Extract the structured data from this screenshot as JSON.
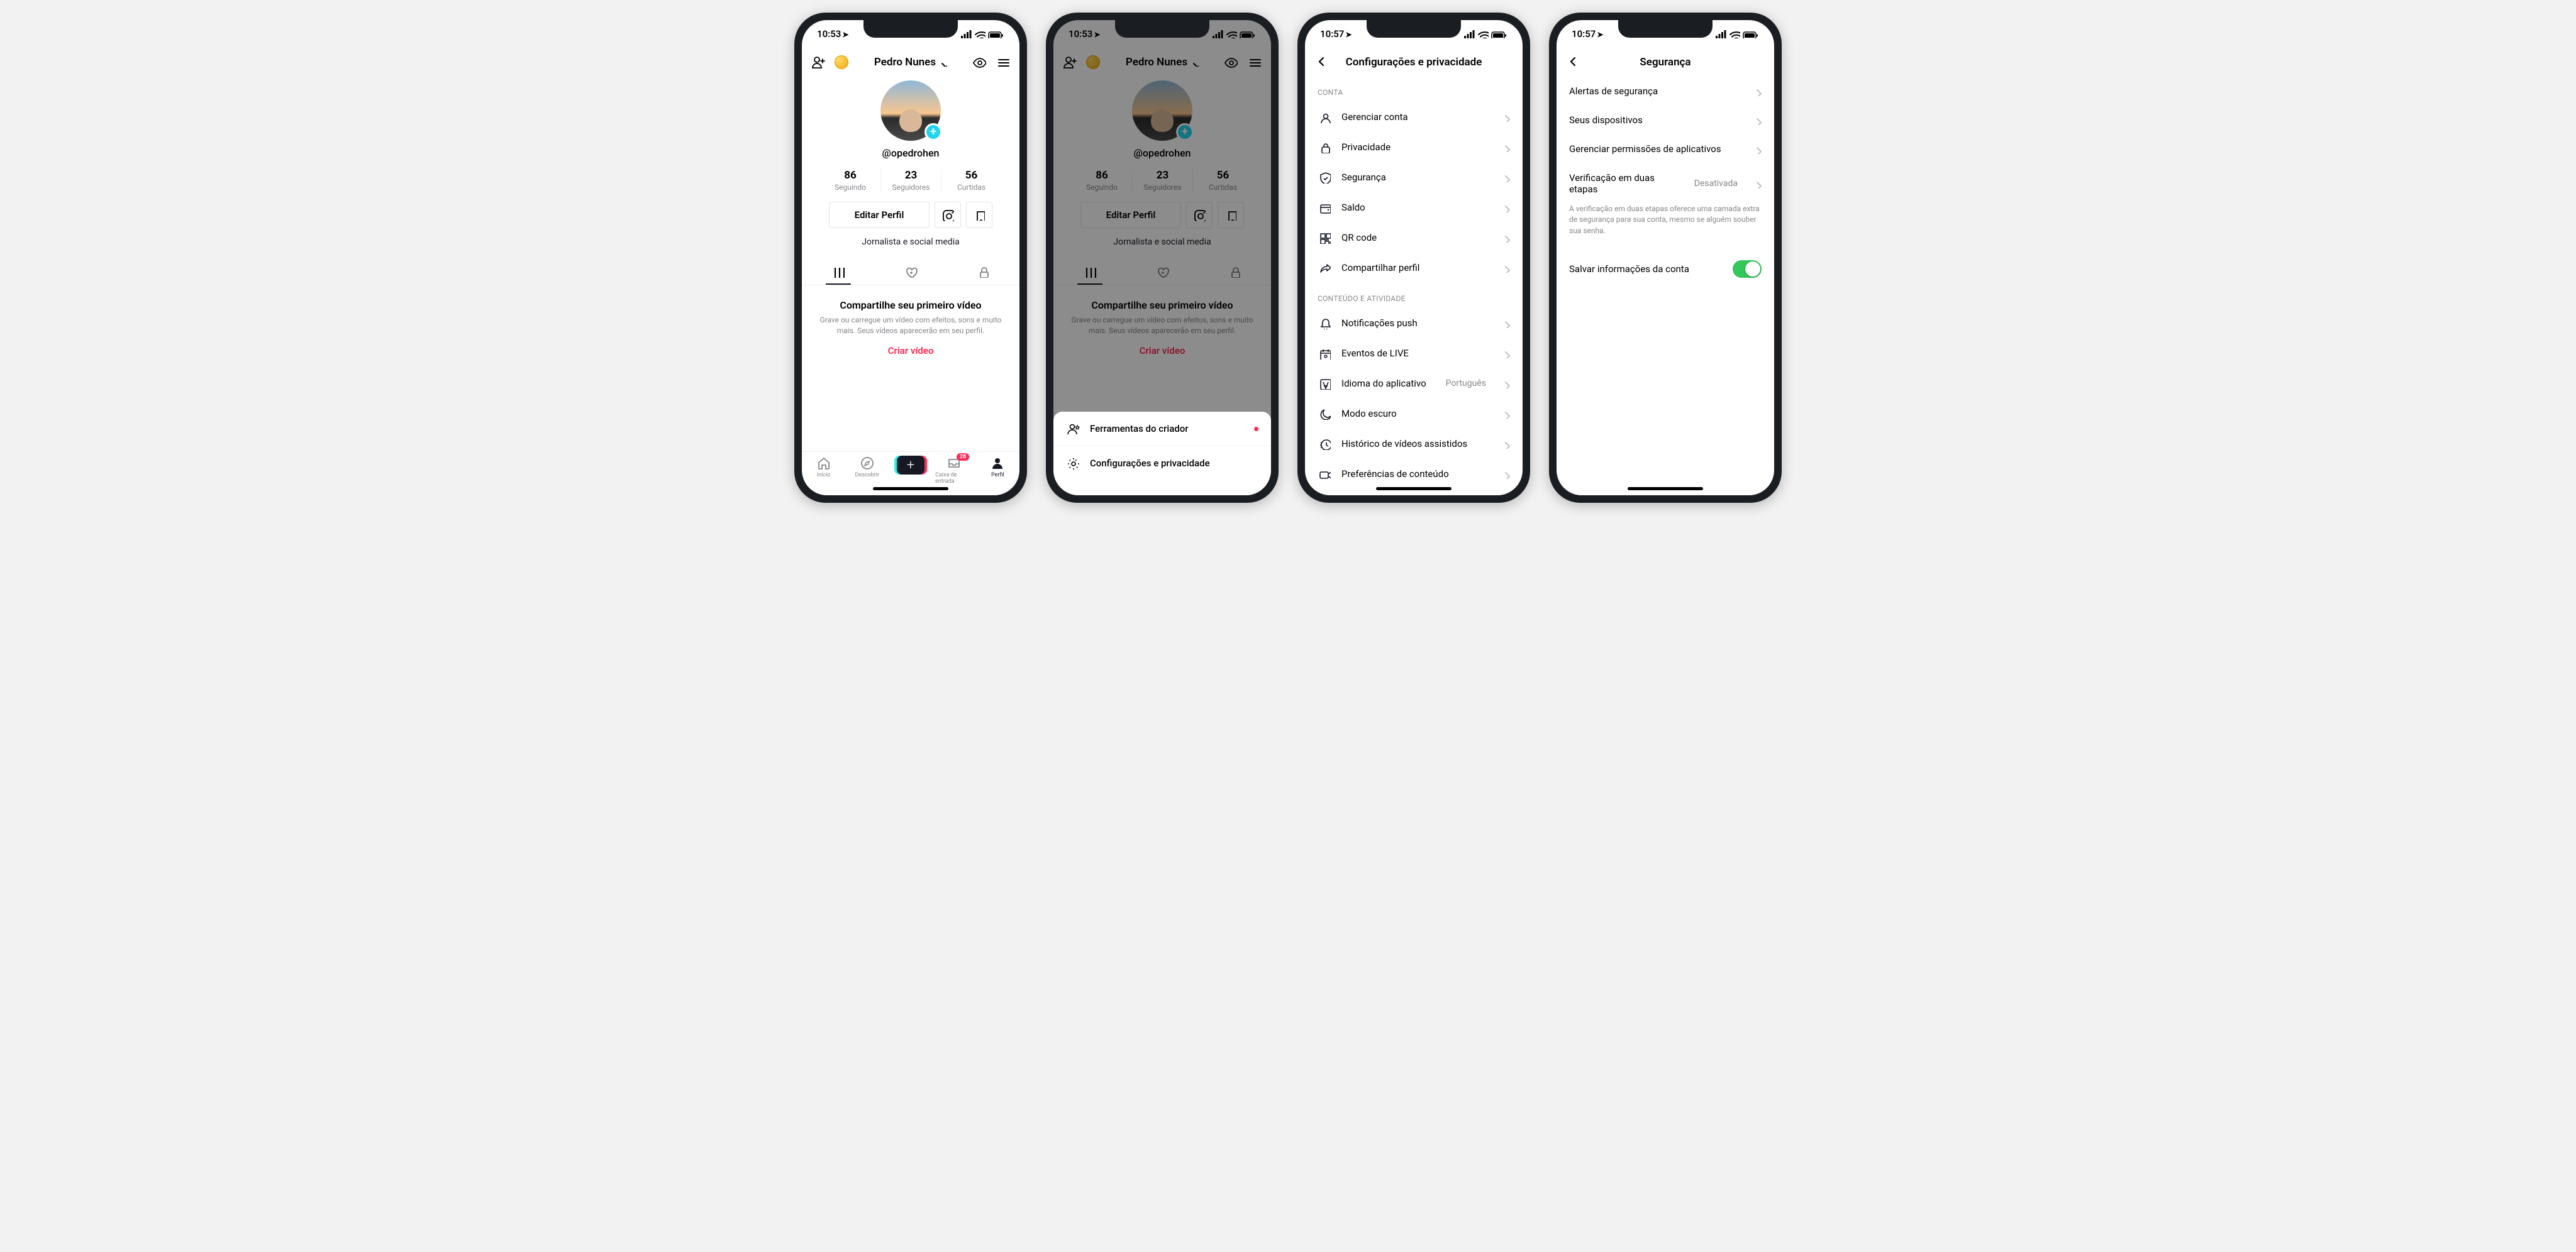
{
  "screen1": {
    "status": {
      "time": "10:53",
      "has_location": true
    },
    "nav": {
      "title": "Pedro Nunes",
      "add_friend_icon": "add-friend-icon",
      "coin_icon": "coin-icon",
      "eye_icon": "eye-icon",
      "menu_icon": "menu-icon"
    },
    "profile": {
      "username": "@opedrohen",
      "stats": [
        {
          "num": "86",
          "label": "Seguindo"
        },
        {
          "num": "23",
          "label": "Seguidores"
        },
        {
          "num": "56",
          "label": "Curtidas"
        }
      ],
      "edit_label": "Editar Perfil",
      "bio": "Jornalista e social media"
    },
    "empty": {
      "title": "Compartilhe seu primeiro vídeo",
      "subtitle": "Grave ou carregue um vídeo com efeitos, sons e muito mais. Seus vídeos aparecerão em seu perfil.",
      "cta": "Criar vídeo"
    },
    "tabbar": {
      "home": "Início",
      "discover": "Descobrir",
      "inbox": "Caixa de entrada",
      "inbox_badge": "28",
      "profile": "Perfil"
    }
  },
  "screen2": {
    "status": {
      "time": "10:53"
    },
    "nav": {
      "title": "Pedro Nunes"
    },
    "profile": {
      "username": "@opedrohen",
      "stats": [
        {
          "num": "86",
          "label": "Seguindo"
        },
        {
          "num": "23",
          "label": "Seguidores"
        },
        {
          "num": "56",
          "label": "Curtidas"
        }
      ],
      "edit_label": "Editar Perfil",
      "bio": "Jornalista e social media"
    },
    "empty": {
      "title": "Compartilhe seu primeiro vídeo",
      "subtitle": "Grave ou carregue um vídeo com efeitos, sons e muito mais. Seus vídeos aparecerão em seu perfil.",
      "cta": "Criar vídeo"
    },
    "sheet": {
      "creator_tools": "Ferramentas do criador",
      "settings_privacy": "Configurações e privacidade"
    }
  },
  "screen3": {
    "status": {
      "time": "10:57"
    },
    "title": "Configurações e privacidade",
    "sections": {
      "account_header": "CONTA",
      "content_header": "CONTEÚDO E ATIVIDADE",
      "account": [
        {
          "key": "manage",
          "label": "Gerenciar conta"
        },
        {
          "key": "privacy",
          "label": "Privacidade"
        },
        {
          "key": "security",
          "label": "Segurança"
        },
        {
          "key": "balance",
          "label": "Saldo"
        },
        {
          "key": "qr",
          "label": "QR code"
        },
        {
          "key": "share",
          "label": "Compartilhar perfil"
        }
      ],
      "content": [
        {
          "key": "push",
          "label": "Notificações push"
        },
        {
          "key": "live",
          "label": "Eventos de LIVE"
        },
        {
          "key": "lang",
          "label": "Idioma do aplicativo",
          "value": "Português"
        },
        {
          "key": "dark",
          "label": "Modo escuro"
        },
        {
          "key": "history",
          "label": "Histórico de vídeos assistidos"
        },
        {
          "key": "prefs",
          "label": "Preferências de conteúdo"
        }
      ]
    }
  },
  "screen4": {
    "status": {
      "time": "10:57"
    },
    "title": "Segurança",
    "items": {
      "alerts": "Alertas de segurança",
      "devices": "Seus dispositivos",
      "permissions": "Gerenciar permissões de aplicativos",
      "twostep": "Verificação em duas etapas",
      "twostep_value": "Desativada",
      "twostep_desc": "A verificação em duas etapas oferece uma camada extra de segurança para sua conta, mesmo se alguém souber sua senha.",
      "save_info": "Salvar informações da conta",
      "save_info_on": true
    }
  }
}
